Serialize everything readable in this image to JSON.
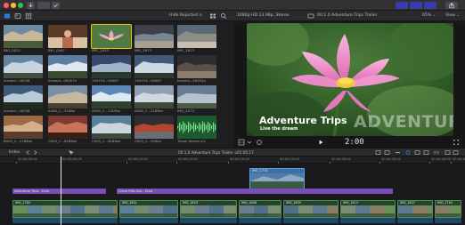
{
  "window": {
    "import_label": "",
    "toolbar": {
      "filter_label": "Hide Rejected ≎",
      "format_label": "1080p HD 23.98p, Stereo",
      "project_title": "00:1.0 Adventure Trips Trailer",
      "zoom_label": "65% ⌄",
      "view_label": "View ⌄"
    }
  },
  "browser": {
    "clips": [
      {
        "name": "IMG_0022"
      },
      {
        "name": "IMG_0067"
      },
      {
        "name": "IMG_2453"
      },
      {
        "name": "IMG_2673"
      },
      {
        "name": "IMG_2873"
      },
      {
        "name": "Iceland...00438"
      },
      {
        "name": "Iceland...000574"
      },
      {
        "name": "150733...00067"
      },
      {
        "name": "150733...00067"
      },
      {
        "name": "Iceland...00452a"
      },
      {
        "name": "Iceland...00036"
      },
      {
        "name": "A008_C...3186a"
      },
      {
        "name": "A009_C...13DTex"
      },
      {
        "name": "A009_C...2186ex"
      },
      {
        "name": "IMG_2073"
      },
      {
        "name": "B009_C...2186ex"
      },
      {
        "name": "C004_C...8186ex"
      },
      {
        "name": "C005_C...8186ex"
      },
      {
        "name": "C003_C...9C6ex"
      },
      {
        "name": "Travel theme v.2"
      }
    ]
  },
  "viewer": {
    "title_main": "Adventure Trips",
    "title_sub": "Live the dream",
    "title_ghost": "ADVENTURE TRIPS",
    "timecode": "2:00"
  },
  "timeline": {
    "index_label": "Index",
    "project_label": "00:1.0 Adventure Trips Trailer ≎  ",
    "duration_label": "01:05:17",
    "ruler": [
      "00:00:00:00",
      "00:00:05:00",
      "00:00:10:00",
      "00:00:15:00",
      "00:00:20:00",
      "00:00:25:00",
      "00:00:30:00",
      "00:00:35:00",
      "00:00:40:00",
      "00:00:45:00"
    ],
    "connected_clip": "IMG_1770",
    "audio_clips": [
      "Adventure Trips - Echo",
      "China Hills Gas - Echo"
    ],
    "primary_clips": [
      "IMG_1783",
      "IMG_1801",
      "IMG_1829",
      "IMG_1808",
      "IMG_1859",
      "IMG_1813",
      "IMG_1827",
      "IMG_1783"
    ]
  },
  "colors": {
    "accent": "#2f7de1",
    "connected": "#3a6fa8",
    "audio": "#7a4fb6",
    "primary": "#2f6a3a"
  }
}
